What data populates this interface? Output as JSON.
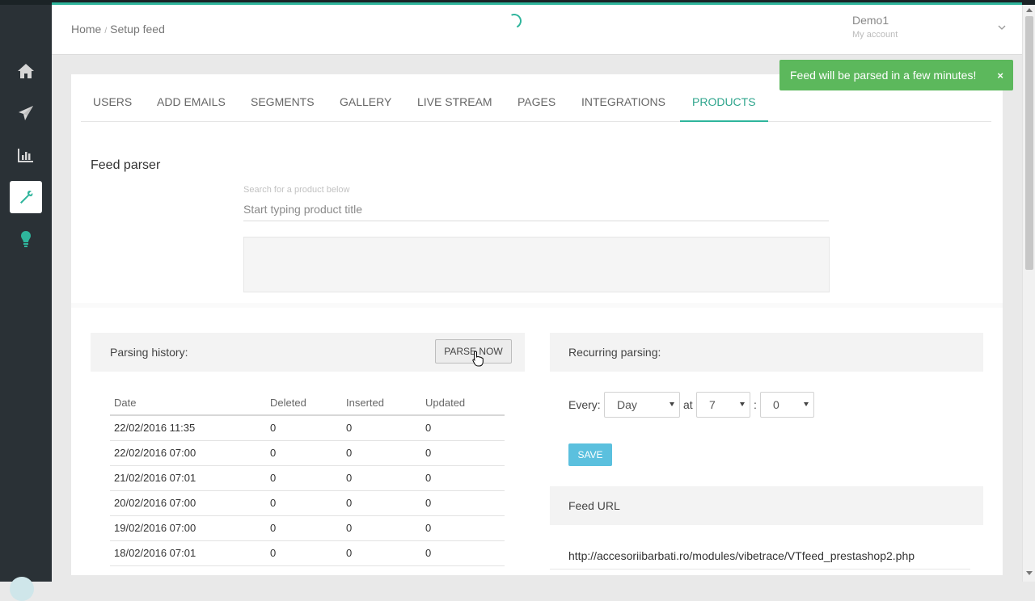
{
  "header": {
    "breadcrumb": [
      "Home",
      "Setup feed"
    ],
    "account_name": "Demo1",
    "account_sub": "My account"
  },
  "sidebar": {
    "items": [
      {
        "icon": "home-icon"
      },
      {
        "icon": "paper-plane-icon"
      },
      {
        "icon": "bar-chart-icon"
      },
      {
        "icon": "wrench-icon",
        "active": true
      },
      {
        "icon": "lightbulb-icon"
      }
    ]
  },
  "tabs": [
    {
      "label": "USERS"
    },
    {
      "label": "ADD EMAILS"
    },
    {
      "label": "SEGMENTS"
    },
    {
      "label": "GALLERY"
    },
    {
      "label": "LIVE STREAM"
    },
    {
      "label": "PAGES"
    },
    {
      "label": "INTEGRATIONS"
    },
    {
      "label": "PRODUCTS",
      "active": true
    }
  ],
  "feed": {
    "title": "Feed parser",
    "search_label": "Search for a product below",
    "search_placeholder": "Start typing product title"
  },
  "history": {
    "title": "Parsing history:",
    "parse_button": "PARSE NOW",
    "columns": [
      "Date",
      "Deleted",
      "Inserted",
      "Updated"
    ],
    "rows": [
      [
        "22/02/2016 11:35",
        "0",
        "0",
        "0"
      ],
      [
        "22/02/2016 07:00",
        "0",
        "0",
        "0"
      ],
      [
        "21/02/2016 07:01",
        "0",
        "0",
        "0"
      ],
      [
        "20/02/2016 07:00",
        "0",
        "0",
        "0"
      ],
      [
        "19/02/2016 07:00",
        "0",
        "0",
        "0"
      ],
      [
        "18/02/2016 07:01",
        "0",
        "0",
        "0"
      ]
    ]
  },
  "recurring": {
    "title": "Recurring parsing:",
    "every_label": "Every:",
    "frequency": "Day",
    "at_label": "at",
    "hour": "7",
    "colon": ":",
    "minute": "0",
    "save_button": "SAVE"
  },
  "feed_url": {
    "title": "Feed URL",
    "url": "http://accesoriibarbati.ro/modules/vibetrace/VTfeed_prestashop2.php"
  },
  "toast": {
    "message": "Feed will be parsed in a few minutes!",
    "close": "×"
  },
  "colors": {
    "accent": "#2fb59c",
    "sidebar": "#2a3136",
    "toast": "#5cb85c",
    "save": "#5bc0de"
  }
}
